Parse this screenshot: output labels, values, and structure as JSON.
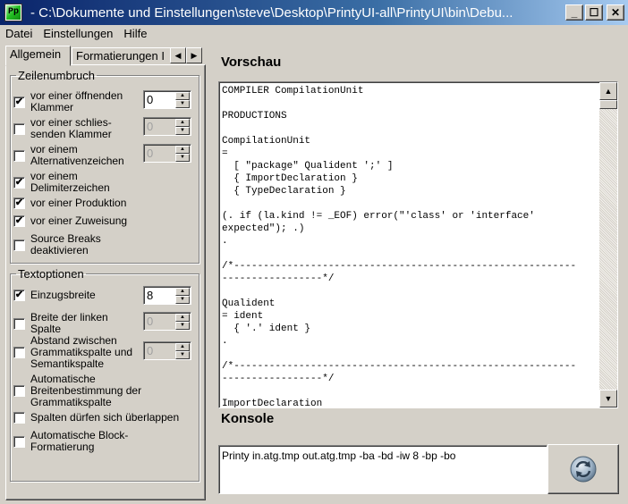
{
  "window": {
    "title": " -  C:\\Dokumente und Einstellungen\\steve\\Desktop\\PrintyUI-all\\PrintyUI\\bin\\Debu...",
    "icon_text": "Pp",
    "minimize_glyph": "_",
    "maximize_glyph": "☐",
    "close_glyph": "✕"
  },
  "menu": [
    "Datei",
    "Einstellungen",
    "Hilfe"
  ],
  "tabs": {
    "items": [
      {
        "label": "Allgemein",
        "active": true
      },
      {
        "label": "Formatierungen I",
        "active": false
      }
    ],
    "scroll_left": "◀",
    "scroll_right": "▶"
  },
  "line_breaks": {
    "title": "Zeilenumbruch",
    "options": [
      {
        "label": "vor einer öffnenden Klammer",
        "checked": true,
        "check": "✔",
        "value": "0",
        "enabled": true
      },
      {
        "label": "vor einer schlies- senden Klammer",
        "checked": false,
        "check": "",
        "value": "0",
        "enabled": false
      },
      {
        "label": "vor einem Alternativenzeichen",
        "checked": false,
        "check": "",
        "value": "0",
        "enabled": false
      },
      {
        "label": "vor einem Delimiterzeichen",
        "checked": true,
        "check": "✔"
      },
      {
        "label": "vor einer Produktion",
        "checked": true,
        "check": "✔"
      },
      {
        "label": "vor einer Zuweisung",
        "checked": true,
        "check": "✔"
      },
      {
        "label": "Source Breaks deaktivieren",
        "checked": false,
        "check": ""
      }
    ]
  },
  "text_options": {
    "title": "Textoptionen",
    "options": [
      {
        "label": "Einzugsbreite",
        "checked": true,
        "check": "✔",
        "value": "8",
        "enabled": true
      },
      {
        "label": "Breite der linken Spalte",
        "checked": false,
        "check": "",
        "value": "0",
        "enabled": false
      },
      {
        "label": "Abstand zwischen Grammatikspalte und Semantikspalte",
        "checked": false,
        "check": "",
        "value": "0",
        "enabled": false
      },
      {
        "label": "Automatische Breitenbestimmung der Grammatikspalte",
        "checked": false,
        "check": ""
      },
      {
        "label": "Spalten dürfen sich überlappen",
        "checked": false,
        "check": ""
      },
      {
        "label": "Automatische Block-Formatierung",
        "checked": false,
        "check": ""
      }
    ]
  },
  "preview": {
    "title": "Vorschau",
    "content": "COMPILER CompilationUnit\n\nPRODUCTIONS\n\nCompilationUnit\n=\n  [ \"package\" Qualident ';' ]\n  { ImportDeclaration }\n  { TypeDeclaration }\n\n(. if (la.kind != _EOF) error(\"'class' or 'interface'\nexpected\"); .)\n.\n\n/*----------------------------------------------------------\n-----------------*/\n\nQualident\n= ident\n  { '.' ident }\n.\n\n/*----------------------------------------------------------\n-----------------*/\n\nImportDeclaration",
    "scroll_up": "▲",
    "scroll_down": "▼"
  },
  "console": {
    "title": "Konsole",
    "text": "Printy in.atg.tmp out.atg.tmp -ba -bd -iw 8 -bp -bo"
  },
  "spin_up": "▲",
  "spin_down": "▼"
}
